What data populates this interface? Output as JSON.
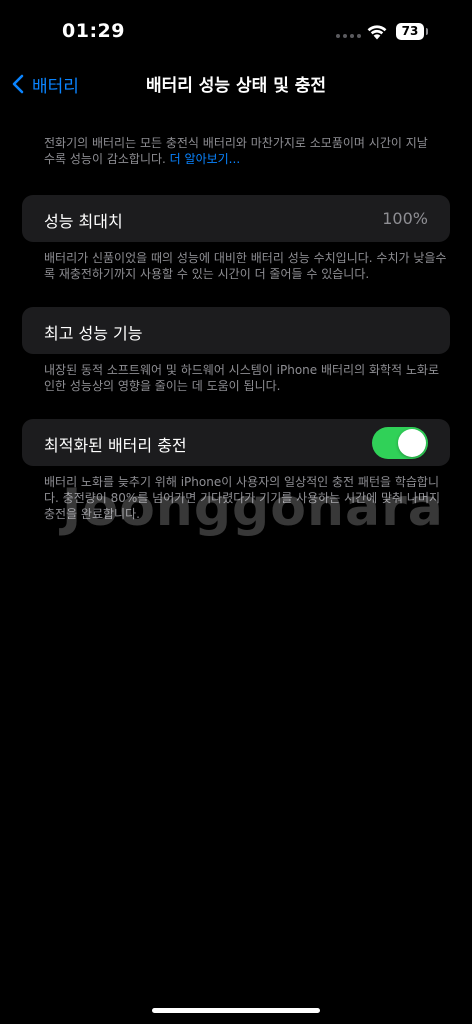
{
  "status_bar": {
    "time": "01:29",
    "battery_level": "73"
  },
  "nav": {
    "back_label": "배터리",
    "title": "배터리 성능 상태 및 충전"
  },
  "intro": {
    "text": "전화기의 배터리는 모든 충전식 배터리와 마찬가지로 소모품이며 시간이 지날수록 성능이 감소합니다. ",
    "link": "더 알아보기..."
  },
  "max_capacity": {
    "label": "성능 최대치",
    "value": "100%",
    "footnote": "배터리가 신품이었을 때의 성능에 대비한 배터리 성능 수치입니다. 수치가 낮을수록 재충전하기까지 사용할 수 있는 시간이 더 줄어들 수 있습니다."
  },
  "peak_performance": {
    "label": "최고 성능 기능",
    "footnote": "내장된 동적 소프트웨어 및 하드웨어 시스템이 iPhone 배터리의 화학적 노화로 인한 성능상의 영향을 줄이는 데 도움이 됩니다."
  },
  "optimized_charging": {
    "label": "최적화된 배터리 충전",
    "enabled": true,
    "footnote": "배터리 노화를 늦추기 위해 iPhone이 사용자의 일상적인 충전 패턴을 학습합니다. 충전량이 80%를 넘어가면 기다렸다가 기기를 사용하는 시간에 맞춰 나머지 충전을 완료합니다."
  },
  "watermark": "Joonggonara",
  "colors": {
    "accent": "#0a84ff",
    "toggle_on": "#30d158",
    "cell_bg": "#1c1c1e",
    "secondary_text": "#8e8e93"
  }
}
